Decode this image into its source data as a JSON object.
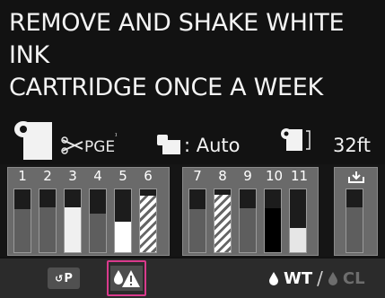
{
  "message": "REMOVE AND SHAKE WHITE INK\nCARTRIDGE ONCE A WEEK",
  "status": {
    "cutter_label": "PGE",
    "feed_mode": ": Auto",
    "remaining_length": "32ft"
  },
  "ink_groups": [
    {
      "slots": [
        {
          "number": "1",
          "level": 0.68,
          "color": "#5e5e5e"
        },
        {
          "number": "2",
          "level": 0.72,
          "color": "#5e5e5e"
        },
        {
          "number": "3",
          "level": 0.72,
          "color": "#f0f0f0"
        },
        {
          "number": "4",
          "level": 0.62,
          "color": "#5e5e5e"
        },
        {
          "number": "5",
          "level": 0.48,
          "color": "#ffffff"
        },
        {
          "number": "6",
          "level": 0.9,
          "color": "hatch"
        }
      ]
    },
    {
      "slots": [
        {
          "number": "7",
          "level": 0.68,
          "color": "#5e5e5e"
        },
        {
          "number": "8",
          "level": 0.92,
          "color": "hatch"
        },
        {
          "number": "9",
          "level": 0.7,
          "color": "#5e5e5e"
        },
        {
          "number": "10",
          "level": 0.7,
          "color": "#000000"
        },
        {
          "number": "11",
          "level": 0.38,
          "color": "#e6e6e6"
        }
      ]
    },
    {
      "slots": [
        {
          "number": "",
          "level": 0.72,
          "color": "#5e5e5e"
        }
      ]
    }
  ],
  "bottom": {
    "paper_button_label": "P",
    "white_ink_label": "WT",
    "separator": "/",
    "clean_ink_label": "CL"
  },
  "colors": {
    "alert_border": "#d93a8c"
  }
}
